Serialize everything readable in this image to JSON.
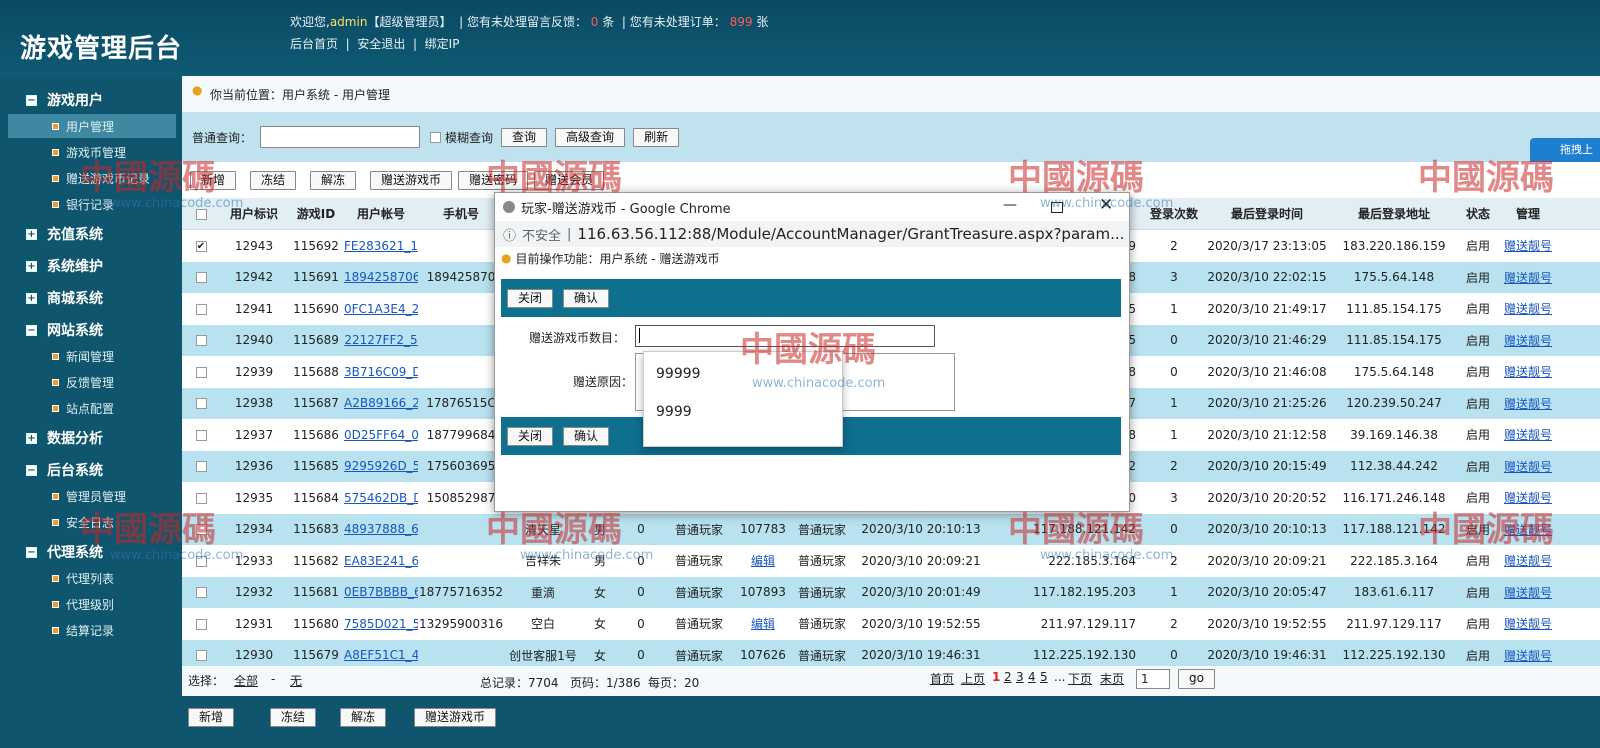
{
  "header": {
    "title": "游戏管理后台",
    "welcome": "欢迎您,",
    "user": "admin",
    "role": "【超级管理员】",
    "msg1_pre": "| 您有未处理留言反馈：",
    "msg1_count": "0",
    "msg1_unit": "条",
    "msg2_pre": "| 您有未处理订单：",
    "msg2_count": "899",
    "msg2_unit": "张",
    "links": [
      "后台首页",
      "安全退出",
      "绑定IP"
    ]
  },
  "sidebar": {
    "sections": [
      {
        "label": "游戏用户",
        "expanded": true,
        "items": [
          "用户管理",
          "游戏币管理",
          "赠送游戏币记录",
          "银行记录"
        ]
      },
      {
        "label": "充值系统",
        "expanded": false,
        "items": []
      },
      {
        "label": "系统维护",
        "expanded": false,
        "items": []
      },
      {
        "label": "商城系统",
        "expanded": false,
        "items": []
      },
      {
        "label": "网站系统",
        "expanded": true,
        "items": [
          "新闻管理",
          "反馈管理",
          "站点配置"
        ]
      },
      {
        "label": "数据分析",
        "expanded": false,
        "items": []
      },
      {
        "label": "后台系统",
        "expanded": true,
        "items": [
          "管理员管理",
          "安全日志"
        ]
      },
      {
        "label": "代理系统",
        "expanded": true,
        "items": [
          "代理列表",
          "代理级别",
          "结算记录"
        ]
      }
    ]
  },
  "location": "你当前位置：用户系统 - 用户管理",
  "search": {
    "label": "普通查询：",
    "fuzzy": "模糊查询",
    "query": "查询",
    "advanced": "高级查询",
    "refresh": "刷新"
  },
  "toolbar": [
    "新增",
    "冻结",
    "解冻",
    "赠送游戏币",
    "赠送密码",
    "赠送会员"
  ],
  "table": {
    "headers": [
      "用户标识",
      "游戏ID",
      "用户帐号",
      "手机号",
      "登录次数",
      "最后登录时间",
      "最后登录地址",
      "状态",
      "管理"
    ],
    "rows": [
      {
        "uid": "12943",
        "gid": "115692",
        "acc": "FE283621_1",
        "phone": "",
        "nick": "",
        "sex": "",
        "n1": "",
        "type": "",
        "n2": "",
        "type2": "",
        "regtime": "",
        "regip": "...159",
        "cnt": "2",
        "last": "2020/3/17 23:13:05",
        "ip": "183.220.186.159",
        "state": "启用",
        "op": "赠送靓号",
        "checked": true
      },
      {
        "uid": "12942",
        "gid": "115691",
        "acc": "1894258706",
        "phone": "189425870",
        "nick": "",
        "sex": "",
        "n1": "",
        "type": "",
        "n2": "",
        "type2": "",
        "regtime": "",
        "regip": "48",
        "cnt": "3",
        "last": "2020/3/10 22:02:15",
        "ip": "175.5.64.148",
        "state": "启用",
        "op": "赠送靓号"
      },
      {
        "uid": "12941",
        "gid": "115690",
        "acc": "0FC1A3E4_2",
        "phone": "",
        "nick": "",
        "sex": "",
        "n1": "",
        "type": "",
        "n2": "",
        "type2": "",
        "regtime": "",
        "regip": "175",
        "cnt": "1",
        "last": "2020/3/10 21:49:17",
        "ip": "111.85.154.175",
        "state": "启用",
        "op": "赠送靓号"
      },
      {
        "uid": "12940",
        "gid": "115689",
        "acc": "22127FF2_5",
        "phone": "",
        "nick": "",
        "sex": "",
        "n1": "",
        "type": "",
        "n2": "",
        "type2": "",
        "regtime": "",
        "regip": "175",
        "cnt": "0",
        "last": "2020/3/10 21:46:29",
        "ip": "111.85.154.175",
        "state": "启用",
        "op": "赠送靓号"
      },
      {
        "uid": "12939",
        "gid": "115688",
        "acc": "3B716C09_D",
        "phone": "",
        "nick": "",
        "sex": "",
        "n1": "",
        "type": "",
        "n2": "",
        "type2": "",
        "regtime": "",
        "regip": "48",
        "cnt": "0",
        "last": "2020/3/10 21:46:08",
        "ip": "175.5.64.148",
        "state": "启用",
        "op": "赠送靓号"
      },
      {
        "uid": "12938",
        "gid": "115687",
        "acc": "A2B89166_2",
        "phone": "17876515C",
        "nick": "",
        "sex": "",
        "n1": "",
        "type": "",
        "n2": "",
        "type2": "",
        "regtime": "",
        "regip": "247",
        "cnt": "1",
        "last": "2020/3/10 21:25:26",
        "ip": "120.239.50.247",
        "state": "启用",
        "op": "赠送靓号"
      },
      {
        "uid": "12937",
        "gid": "115686",
        "acc": "0D25FF64_0",
        "phone": "187799684",
        "nick": "",
        "sex": "",
        "n1": "",
        "type": "",
        "n2": "",
        "type2": "",
        "regtime": "",
        "regip": ".38",
        "cnt": "1",
        "last": "2020/3/10 21:12:58",
        "ip": "39.169.146.38",
        "state": "启用",
        "op": "赠送靓号"
      },
      {
        "uid": "12936",
        "gid": "115685",
        "acc": "9295926D_5",
        "phone": "175603695",
        "nick": "",
        "sex": "",
        "n1": "",
        "type": "",
        "n2": "",
        "type2": "",
        "regtime": "",
        "regip": "242",
        "cnt": "2",
        "last": "2020/3/10 20:15:49",
        "ip": "112.38.44.242",
        "state": "启用",
        "op": "赠送靓号"
      },
      {
        "uid": "12935",
        "gid": "115684",
        "acc": "575462DB_D",
        "phone": "150852987",
        "nick": "",
        "sex": "",
        "n1": "",
        "type": "",
        "n2": "",
        "type2": "",
        "regtime": "",
        "regip": "240",
        "cnt": "3",
        "last": "2020/3/10 20:20:52",
        "ip": "116.171.246.148",
        "state": "启用",
        "op": "赠送靓号"
      },
      {
        "uid": "12934",
        "gid": "115683",
        "acc": "48937888_6",
        "phone": "",
        "nick": "清天星",
        "sex": "男",
        "n1": "0",
        "type": "普通玩家",
        "n2": "107783",
        "type2": "普通玩家",
        "regtime": "2020/3/10 20:10:13",
        "regip": "117.188.121.142",
        "cnt": "0",
        "last": "2020/3/10 20:10:13",
        "ip": "117.188.121.142",
        "state": "启用",
        "op": "赠送靓号"
      },
      {
        "uid": "12933",
        "gid": "115682",
        "acc": "EA83E241_6",
        "phone": "",
        "nick": "吉祥朱",
        "sex": "男",
        "n1": "0",
        "type": "普通玩家",
        "n2": "编辑",
        "type2": "普通玩家",
        "regtime": "2020/3/10 20:09:21",
        "regip": "222.185.3.164",
        "cnt": "2",
        "last": "2020/3/10 20:09:21",
        "ip": "222.185.3.164",
        "state": "启用",
        "op": "赠送靓号",
        "n2link": true
      },
      {
        "uid": "12932",
        "gid": "115681",
        "acc": "0EB7BBBB_6",
        "phone": "18775716352",
        "nick": "重滴",
        "sex": "女",
        "n1": "0",
        "type": "普通玩家",
        "n2": "107893",
        "type2": "普通玩家",
        "regtime": "2020/3/10 20:01:49",
        "regip": "117.182.195.203",
        "cnt": "1",
        "last": "2020/3/10 20:05:47",
        "ip": "183.61.6.117",
        "state": "启用",
        "op": "赠送靓号"
      },
      {
        "uid": "12931",
        "gid": "115680",
        "acc": "7585D021_5",
        "phone": "13295900316",
        "nick": "空白",
        "sex": "女",
        "n1": "0",
        "type": "普通玩家",
        "n2": "编辑",
        "type2": "普通玩家",
        "regtime": "2020/3/10 19:52:55",
        "regip": "211.97.129.117",
        "cnt": "2",
        "last": "2020/3/10 19:52:55",
        "ip": "211.97.129.117",
        "state": "启用",
        "op": "赠送靓号",
        "n2link": true
      },
      {
        "uid": "12930",
        "gid": "115679",
        "acc": "A8EF51C1_4",
        "phone": "",
        "nick": "创世客服1号",
        "sex": "女",
        "n1": "0",
        "type": "普通玩家",
        "n2": "107626",
        "type2": "普通玩家",
        "regtime": "2020/3/10 19:46:31",
        "regip": "112.225.192.130",
        "cnt": "0",
        "last": "2020/3/10 19:46:31",
        "ip": "112.225.192.130",
        "state": "启用",
        "op": "赠送靓号"
      }
    ]
  },
  "footer": {
    "select": "选择：",
    "all": "全部",
    "dash": "-",
    "none": "无",
    "total": "总记录：7704",
    "pages": "页码：1/386",
    "perpage": "每页：20",
    "first": "首页",
    "prev": "上页",
    "pagenums": [
      "1",
      "2",
      "3",
      "4",
      "5"
    ],
    "ellipsis": "...",
    "next": "下页",
    "last": "末页",
    "goto_value": "1",
    "go": "go"
  },
  "bottom_buttons": [
    "新增",
    "冻结",
    "解冻",
    "赠送游戏币"
  ],
  "dialog": {
    "title": "玩家-赠送游戏币 - Google Chrome",
    "not_secure": "不安全",
    "url": "116.63.56.112:88/Module/AccountManager/GrantTreasure.aspx?param...",
    "func": "目前操作功能：用户系统 - 赠送游戏币",
    "close": "关闭",
    "confirm": "确认",
    "amount_label": "赠送游戏币数目：",
    "reason_label": "赠送原因：",
    "suggestions": [
      "99999",
      "9999"
    ]
  },
  "watermark": {
    "text": "中國源碼",
    "site": "www.chinacode.com"
  },
  "side_widget": "拖拽上"
}
